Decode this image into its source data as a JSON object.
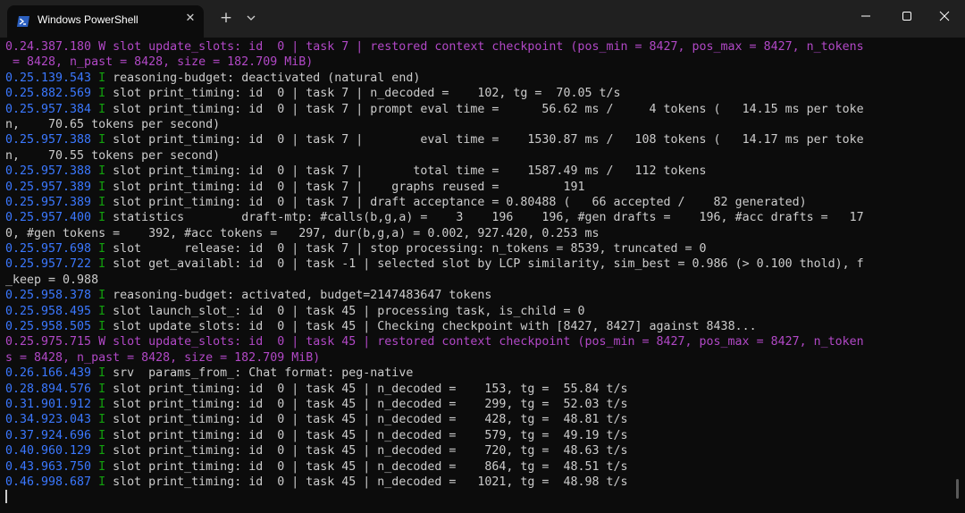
{
  "window": {
    "tab_title": "Windows PowerShell",
    "tab_close_glyph": "✕",
    "new_tab_glyph": "+",
    "icons": {
      "tab": "powershell-icon",
      "dropdown": "chevron-down-icon",
      "minimize": "minimize-icon",
      "maximize": "maximize-icon",
      "close": "close-icon"
    }
  },
  "colors": {
    "background": "#0c0c0c",
    "titlebar": "#202020",
    "timestamp": "#3b78ff",
    "level_info": "#13a10e",
    "warning_text": "#b148c6",
    "default_text": "#cccccc"
  },
  "terminal": {
    "lines": [
      {
        "segments": [
          {
            "t": "0.24.387.180 W slot update_slots: id  0 | task 7 | restored context checkpoint (pos_min = 8427, pos_max = 8427, n_tokens",
            "c": "warn"
          }
        ]
      },
      {
        "segments": [
          {
            "t": " = 8428, n_past = 8428, size = 182.709 MiB)",
            "c": "warn"
          }
        ]
      },
      {
        "segments": [
          {
            "t": "0.25.139.543",
            "c": "ts"
          },
          {
            "t": " I",
            "c": "lvl-I"
          },
          {
            "t": " reasoning-budget: deactivated (natural end)",
            "c": ""
          }
        ]
      },
      {
        "segments": [
          {
            "t": "0.25.882.569",
            "c": "ts"
          },
          {
            "t": " I",
            "c": "lvl-I"
          },
          {
            "t": " slot print_timing: id  0 | task 7 | n_decoded =    102, tg =  70.05 t/s",
            "c": ""
          }
        ]
      },
      {
        "segments": [
          {
            "t": "0.25.957.384",
            "c": "ts"
          },
          {
            "t": " I",
            "c": "lvl-I"
          },
          {
            "t": " slot print_timing: id  0 | task 7 | prompt eval time =      56.62 ms /     4 tokens (   14.15 ms per toke",
            "c": ""
          }
        ]
      },
      {
        "segments": [
          {
            "t": "n,    70.65 tokens per second)",
            "c": ""
          }
        ]
      },
      {
        "segments": [
          {
            "t": "0.25.957.388",
            "c": "ts"
          },
          {
            "t": " I",
            "c": "lvl-I"
          },
          {
            "t": " slot print_timing: id  0 | task 7 |        eval time =    1530.87 ms /   108 tokens (   14.17 ms per toke",
            "c": ""
          }
        ]
      },
      {
        "segments": [
          {
            "t": "n,    70.55 tokens per second)",
            "c": ""
          }
        ]
      },
      {
        "segments": [
          {
            "t": "0.25.957.388",
            "c": "ts"
          },
          {
            "t": " I",
            "c": "lvl-I"
          },
          {
            "t": " slot print_timing: id  0 | task 7 |       total time =    1587.49 ms /   112 tokens",
            "c": ""
          }
        ]
      },
      {
        "segments": [
          {
            "t": "0.25.957.389",
            "c": "ts"
          },
          {
            "t": " I",
            "c": "lvl-I"
          },
          {
            "t": " slot print_timing: id  0 | task 7 |    graphs reused =         191",
            "c": ""
          }
        ]
      },
      {
        "segments": [
          {
            "t": "0.25.957.389",
            "c": "ts"
          },
          {
            "t": " I",
            "c": "lvl-I"
          },
          {
            "t": " slot print_timing: id  0 | task 7 | draft acceptance = 0.80488 (   66 accepted /    82 generated)",
            "c": ""
          }
        ]
      },
      {
        "segments": [
          {
            "t": "0.25.957.400",
            "c": "ts"
          },
          {
            "t": " I",
            "c": "lvl-I"
          },
          {
            "t": " statistics        draft-mtp: #calls(b,g,a) =    3    196    196, #gen drafts =    196, #acc drafts =   17",
            "c": ""
          }
        ]
      },
      {
        "segments": [
          {
            "t": "0, #gen tokens =    392, #acc tokens =   297, dur(b,g,a) = 0.002, 927.420, 0.253 ms",
            "c": ""
          }
        ]
      },
      {
        "segments": [
          {
            "t": "0.25.957.698",
            "c": "ts"
          },
          {
            "t": " I",
            "c": "lvl-I"
          },
          {
            "t": " slot      release: id  0 | task 7 | stop processing: n_tokens = 8539, truncated = 0",
            "c": ""
          }
        ]
      },
      {
        "segments": [
          {
            "t": "0.25.957.722",
            "c": "ts"
          },
          {
            "t": " I",
            "c": "lvl-I"
          },
          {
            "t": " slot get_availabl: id  0 | task -1 | selected slot by LCP similarity, sim_best = 0.986 (> 0.100 thold), f",
            "c": ""
          }
        ]
      },
      {
        "segments": [
          {
            "t": "_keep = 0.988",
            "c": ""
          }
        ]
      },
      {
        "segments": [
          {
            "t": "0.25.958.378",
            "c": "ts"
          },
          {
            "t": " I",
            "c": "lvl-I"
          },
          {
            "t": " reasoning-budget: activated, budget=2147483647 tokens",
            "c": ""
          }
        ]
      },
      {
        "segments": [
          {
            "t": "0.25.958.495",
            "c": "ts"
          },
          {
            "t": " I",
            "c": "lvl-I"
          },
          {
            "t": " slot launch_slot_: id  0 | task 45 | processing task, is_child = 0",
            "c": ""
          }
        ]
      },
      {
        "segments": [
          {
            "t": "0.25.958.505",
            "c": "ts"
          },
          {
            "t": " I",
            "c": "lvl-I"
          },
          {
            "t": " slot update_slots: id  0 | task 45 | Checking checkpoint with [8427, 8427] against 8438...",
            "c": ""
          }
        ]
      },
      {
        "segments": [
          {
            "t": "0.25.975.715 W slot update_slots: id  0 | task 45 | restored context checkpoint (pos_min = 8427, pos_max = 8427, n_token",
            "c": "warn"
          }
        ]
      },
      {
        "segments": [
          {
            "t": "s = 8428, n_past = 8428, size = 182.709 MiB)",
            "c": "warn"
          }
        ]
      },
      {
        "segments": [
          {
            "t": "0.26.166.439",
            "c": "ts"
          },
          {
            "t": " I",
            "c": "lvl-I"
          },
          {
            "t": " srv  params_from_: Chat format: peg-native",
            "c": ""
          }
        ]
      },
      {
        "segments": [
          {
            "t": "0.28.894.576",
            "c": "ts"
          },
          {
            "t": " I",
            "c": "lvl-I"
          },
          {
            "t": " slot print_timing: id  0 | task 45 | n_decoded =    153, tg =  55.84 t/s",
            "c": ""
          }
        ]
      },
      {
        "segments": [
          {
            "t": "0.31.901.912",
            "c": "ts"
          },
          {
            "t": " I",
            "c": "lvl-I"
          },
          {
            "t": " slot print_timing: id  0 | task 45 | n_decoded =    299, tg =  52.03 t/s",
            "c": ""
          }
        ]
      },
      {
        "segments": [
          {
            "t": "0.34.923.043",
            "c": "ts"
          },
          {
            "t": " I",
            "c": "lvl-I"
          },
          {
            "t": " slot print_timing: id  0 | task 45 | n_decoded =    428, tg =  48.81 t/s",
            "c": ""
          }
        ]
      },
      {
        "segments": [
          {
            "t": "0.37.924.696",
            "c": "ts"
          },
          {
            "t": " I",
            "c": "lvl-I"
          },
          {
            "t": " slot print_timing: id  0 | task 45 | n_decoded =    579, tg =  49.19 t/s",
            "c": ""
          }
        ]
      },
      {
        "segments": [
          {
            "t": "0.40.960.129",
            "c": "ts"
          },
          {
            "t": " I",
            "c": "lvl-I"
          },
          {
            "t": " slot print_timing: id  0 | task 45 | n_decoded =    720, tg =  48.63 t/s",
            "c": ""
          }
        ]
      },
      {
        "segments": [
          {
            "t": "0.43.963.750",
            "c": "ts"
          },
          {
            "t": " I",
            "c": "lvl-I"
          },
          {
            "t": " slot print_timing: id  0 | task 45 | n_decoded =    864, tg =  48.51 t/s",
            "c": ""
          }
        ]
      },
      {
        "segments": [
          {
            "t": "0.46.998.687",
            "c": "ts"
          },
          {
            "t": " I",
            "c": "lvl-I"
          },
          {
            "t": " slot print_timing: id  0 | task 45 | n_decoded =   1021, tg =  48.98 t/s",
            "c": ""
          }
        ]
      }
    ]
  }
}
